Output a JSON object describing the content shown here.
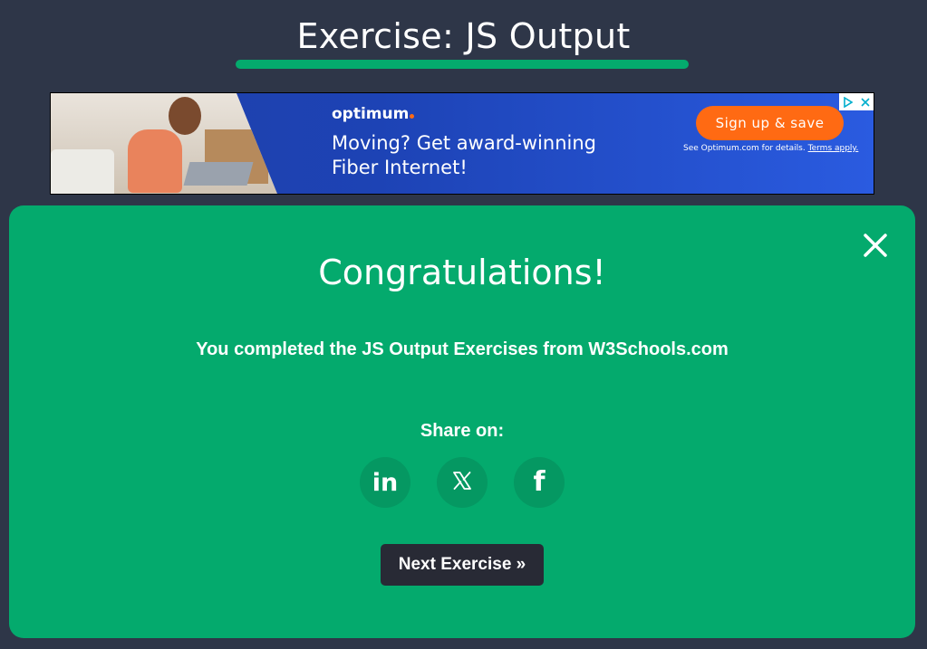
{
  "page": {
    "title": "Exercise: JS Output"
  },
  "ad": {
    "brand": "optimum",
    "headline_line1": "Moving? Get award-winning",
    "headline_line2": "Fiber Internet!",
    "cta_label": "Sign up & save",
    "disclaimer_prefix": "See Optimum.com for details.",
    "disclaimer_link": "Terms apply.",
    "adchoices_icons": [
      "adchoices-icon",
      "close-ad-icon"
    ]
  },
  "dialog": {
    "title": "Congratulations!",
    "message": "You completed the JS Output Exercises from W3Schools.com",
    "share_label": "Share on:",
    "share_buttons": [
      {
        "icon": "linkedin-icon",
        "label": "in"
      },
      {
        "icon": "x-icon",
        "label": "X"
      },
      {
        "icon": "facebook-icon",
        "label": "f"
      }
    ],
    "next_label": "Next Exercise »",
    "close_icon": "close-icon"
  },
  "colors": {
    "background": "#2e3648",
    "accent": "#04aa6d",
    "share_circle": "#059862",
    "next_button": "#282a35",
    "ad_cta": "#ff6a13"
  }
}
